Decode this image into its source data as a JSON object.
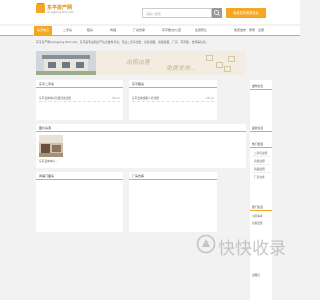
{
  "header": {
    "logo_name": "东平房产网",
    "logo_sub": "dongping.tfsh.net",
    "search_placeholder": "请输入搜索",
    "post_label": "免费发布房源信息"
  },
  "nav": {
    "items": [
      "房源信息",
      "二手房",
      "租房",
      "商铺",
      "厂房仓库",
      "写字楼/办公室",
      "生意转让"
    ],
    "right": [
      "免费发布",
      "登录",
      "注册"
    ]
  },
  "intro": "东平房产网(dongping.tfsh.net)，东平最专业的房产信息发布平台，专业二手房出售、房屋出租、商铺出租、厂房、写字楼、仓库等信息。",
  "banner": {
    "text1": "出租出售",
    "text2": "免费发布..."
  },
  "panels": {
    "secondhand": {
      "title": "东平二手房",
      "rows": [
        {
          "text": "东平县城中心位置房屋出售",
          "date": "08-12"
        }
      ]
    },
    "rent": {
      "title": "东平租房",
      "rows": [
        {
          "text": "东平县城出租人房合租",
          "date": "08-12"
        }
      ]
    },
    "photos": {
      "title": "图片房源",
      "caption": "东平县城中心..."
    },
    "shop": {
      "title": "商铺门面房"
    },
    "factory": {
      "title": "厂房仓库"
    }
  },
  "side": {
    "s1": {
      "title": "发布信息"
    },
    "s2": {
      "title": "最新信息"
    },
    "s3": {
      "title": "热门栏目",
      "items": [
        "二手房出售",
        "房屋出租",
        "商铺出租",
        "厂房仓库"
      ]
    },
    "s4": {
      "title": "热门信息",
      "items": [
        "小区车库",
        "房屋出售"
      ]
    },
    "bottom_item": "出租房"
  },
  "watermark": {
    "text": "快快收录"
  }
}
